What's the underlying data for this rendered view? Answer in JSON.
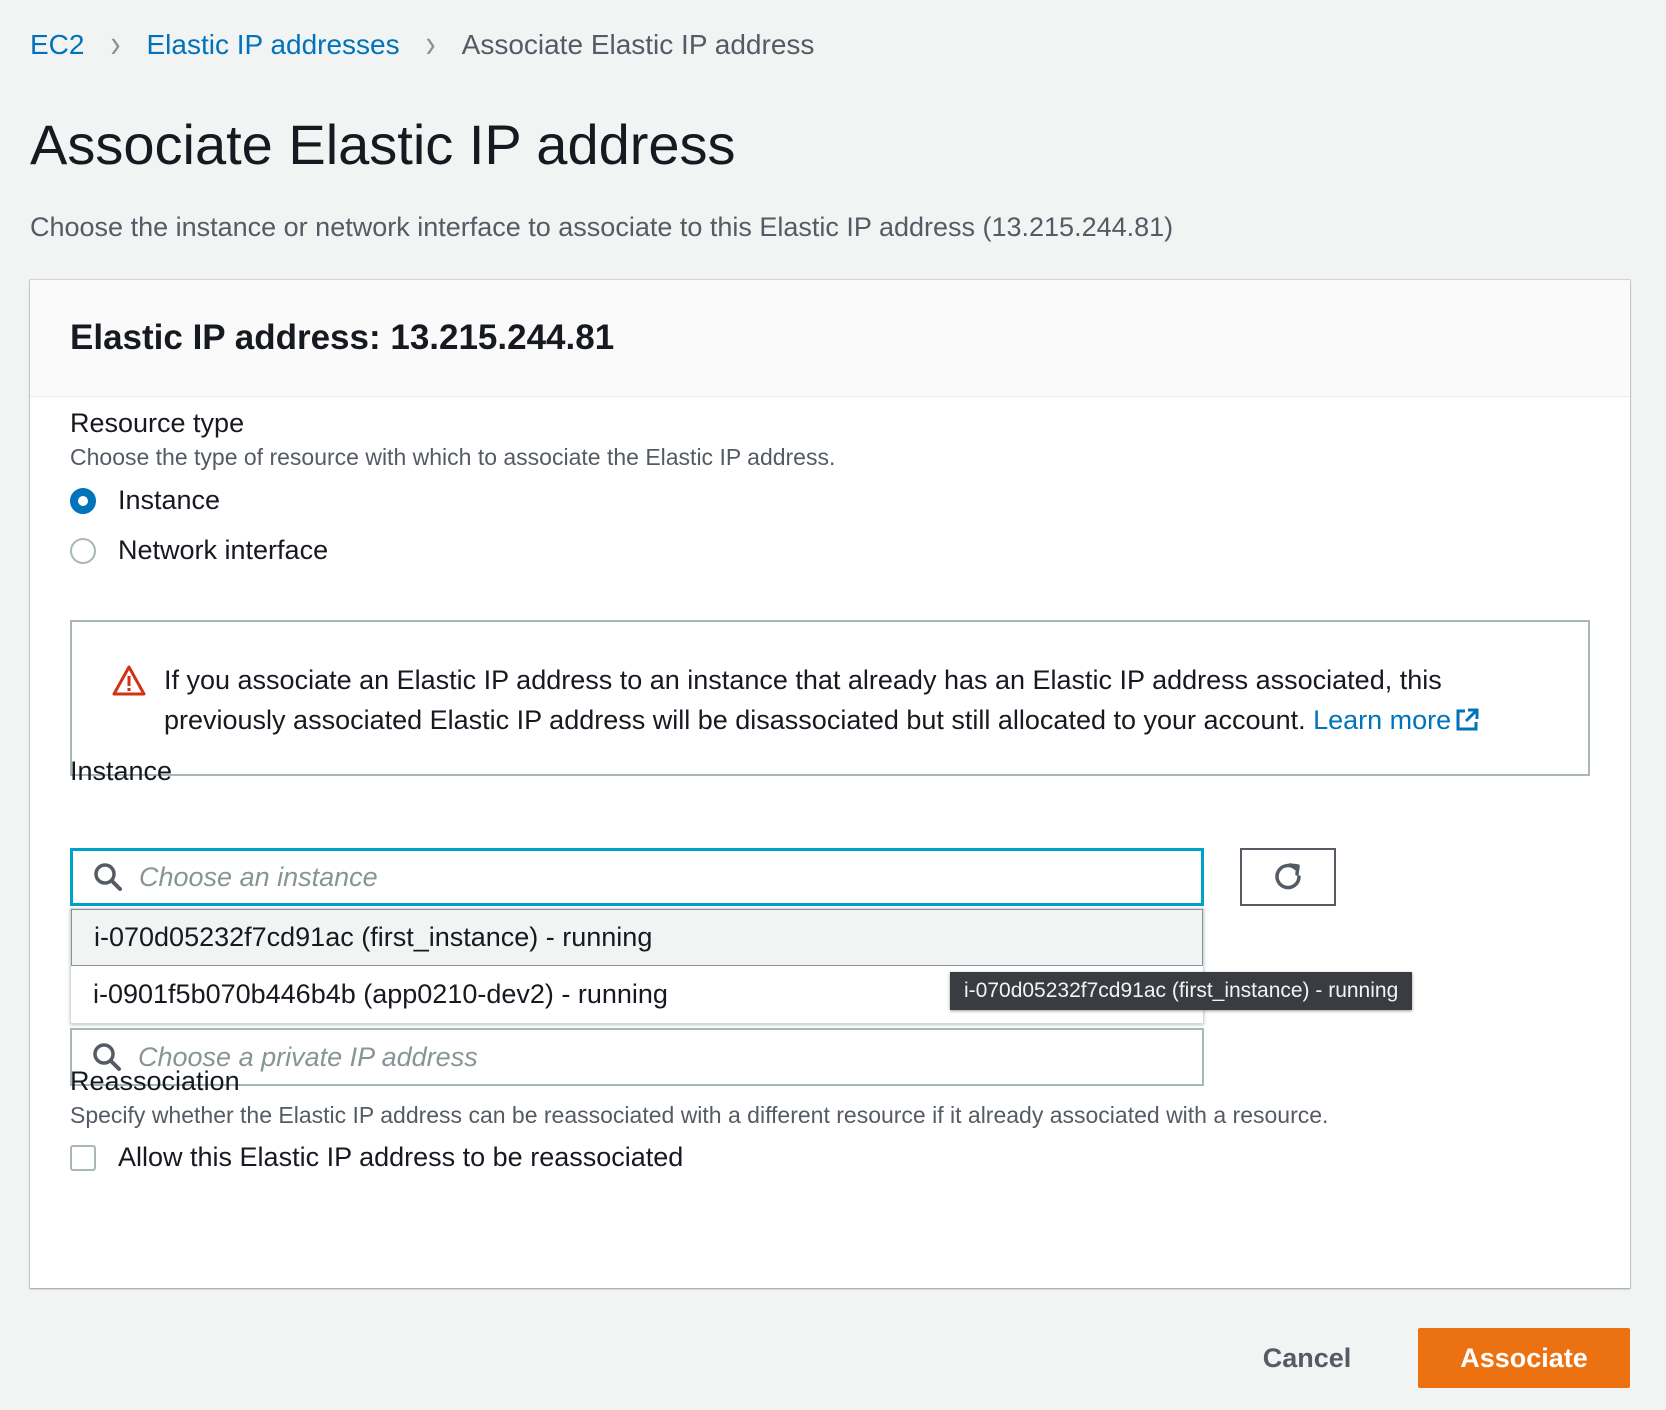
{
  "breadcrumb": {
    "items": [
      "EC2",
      "Elastic IP addresses"
    ],
    "current": "Associate Elastic IP address"
  },
  "page": {
    "title": "Associate Elastic IP address",
    "description": "Choose the instance or network interface to associate to this Elastic IP address (13.215.244.81)"
  },
  "panel": {
    "header": "Elastic IP address: 13.215.244.81",
    "resource_type": {
      "label": "Resource type",
      "help": "Choose the type of resource with which to associate the Elastic IP address.",
      "options": [
        {
          "label": "Instance",
          "checked": true
        },
        {
          "label": "Network interface",
          "checked": false
        }
      ]
    },
    "warning": {
      "text": "If you associate an Elastic IP address to an instance that already has an Elastic IP address associated, this previously associated Elastic IP address will be disassociated but still allocated to your account.",
      "link": "Learn more"
    },
    "instance": {
      "label": "Instance",
      "placeholder": "Choose an instance",
      "options": [
        "i-070d05232f7cd91ac (first_instance) - running",
        "i-0901f5b070b446b4b (app0210-dev2) - running"
      ],
      "tooltip": "i-070d05232f7cd91ac (first_instance) - running"
    },
    "private_ip": {
      "placeholder": "Choose a private IP address"
    },
    "reassociation": {
      "label": "Reassociation",
      "help": "Specify whether the Elastic IP address can be reassociated with a different resource if it already associated with a resource.",
      "checkbox_label": "Allow this Elastic IP address to be reassociated",
      "checked": false
    }
  },
  "actions": {
    "cancel": "Cancel",
    "associate": "Associate"
  },
  "colors": {
    "link": "#0073bb",
    "primary": "#ec7211",
    "focus": "#00a1c9",
    "warning": "#d13212"
  },
  "icons": [
    "chevron-right-icon",
    "warning-icon",
    "external-link-icon",
    "search-icon",
    "refresh-icon"
  ]
}
